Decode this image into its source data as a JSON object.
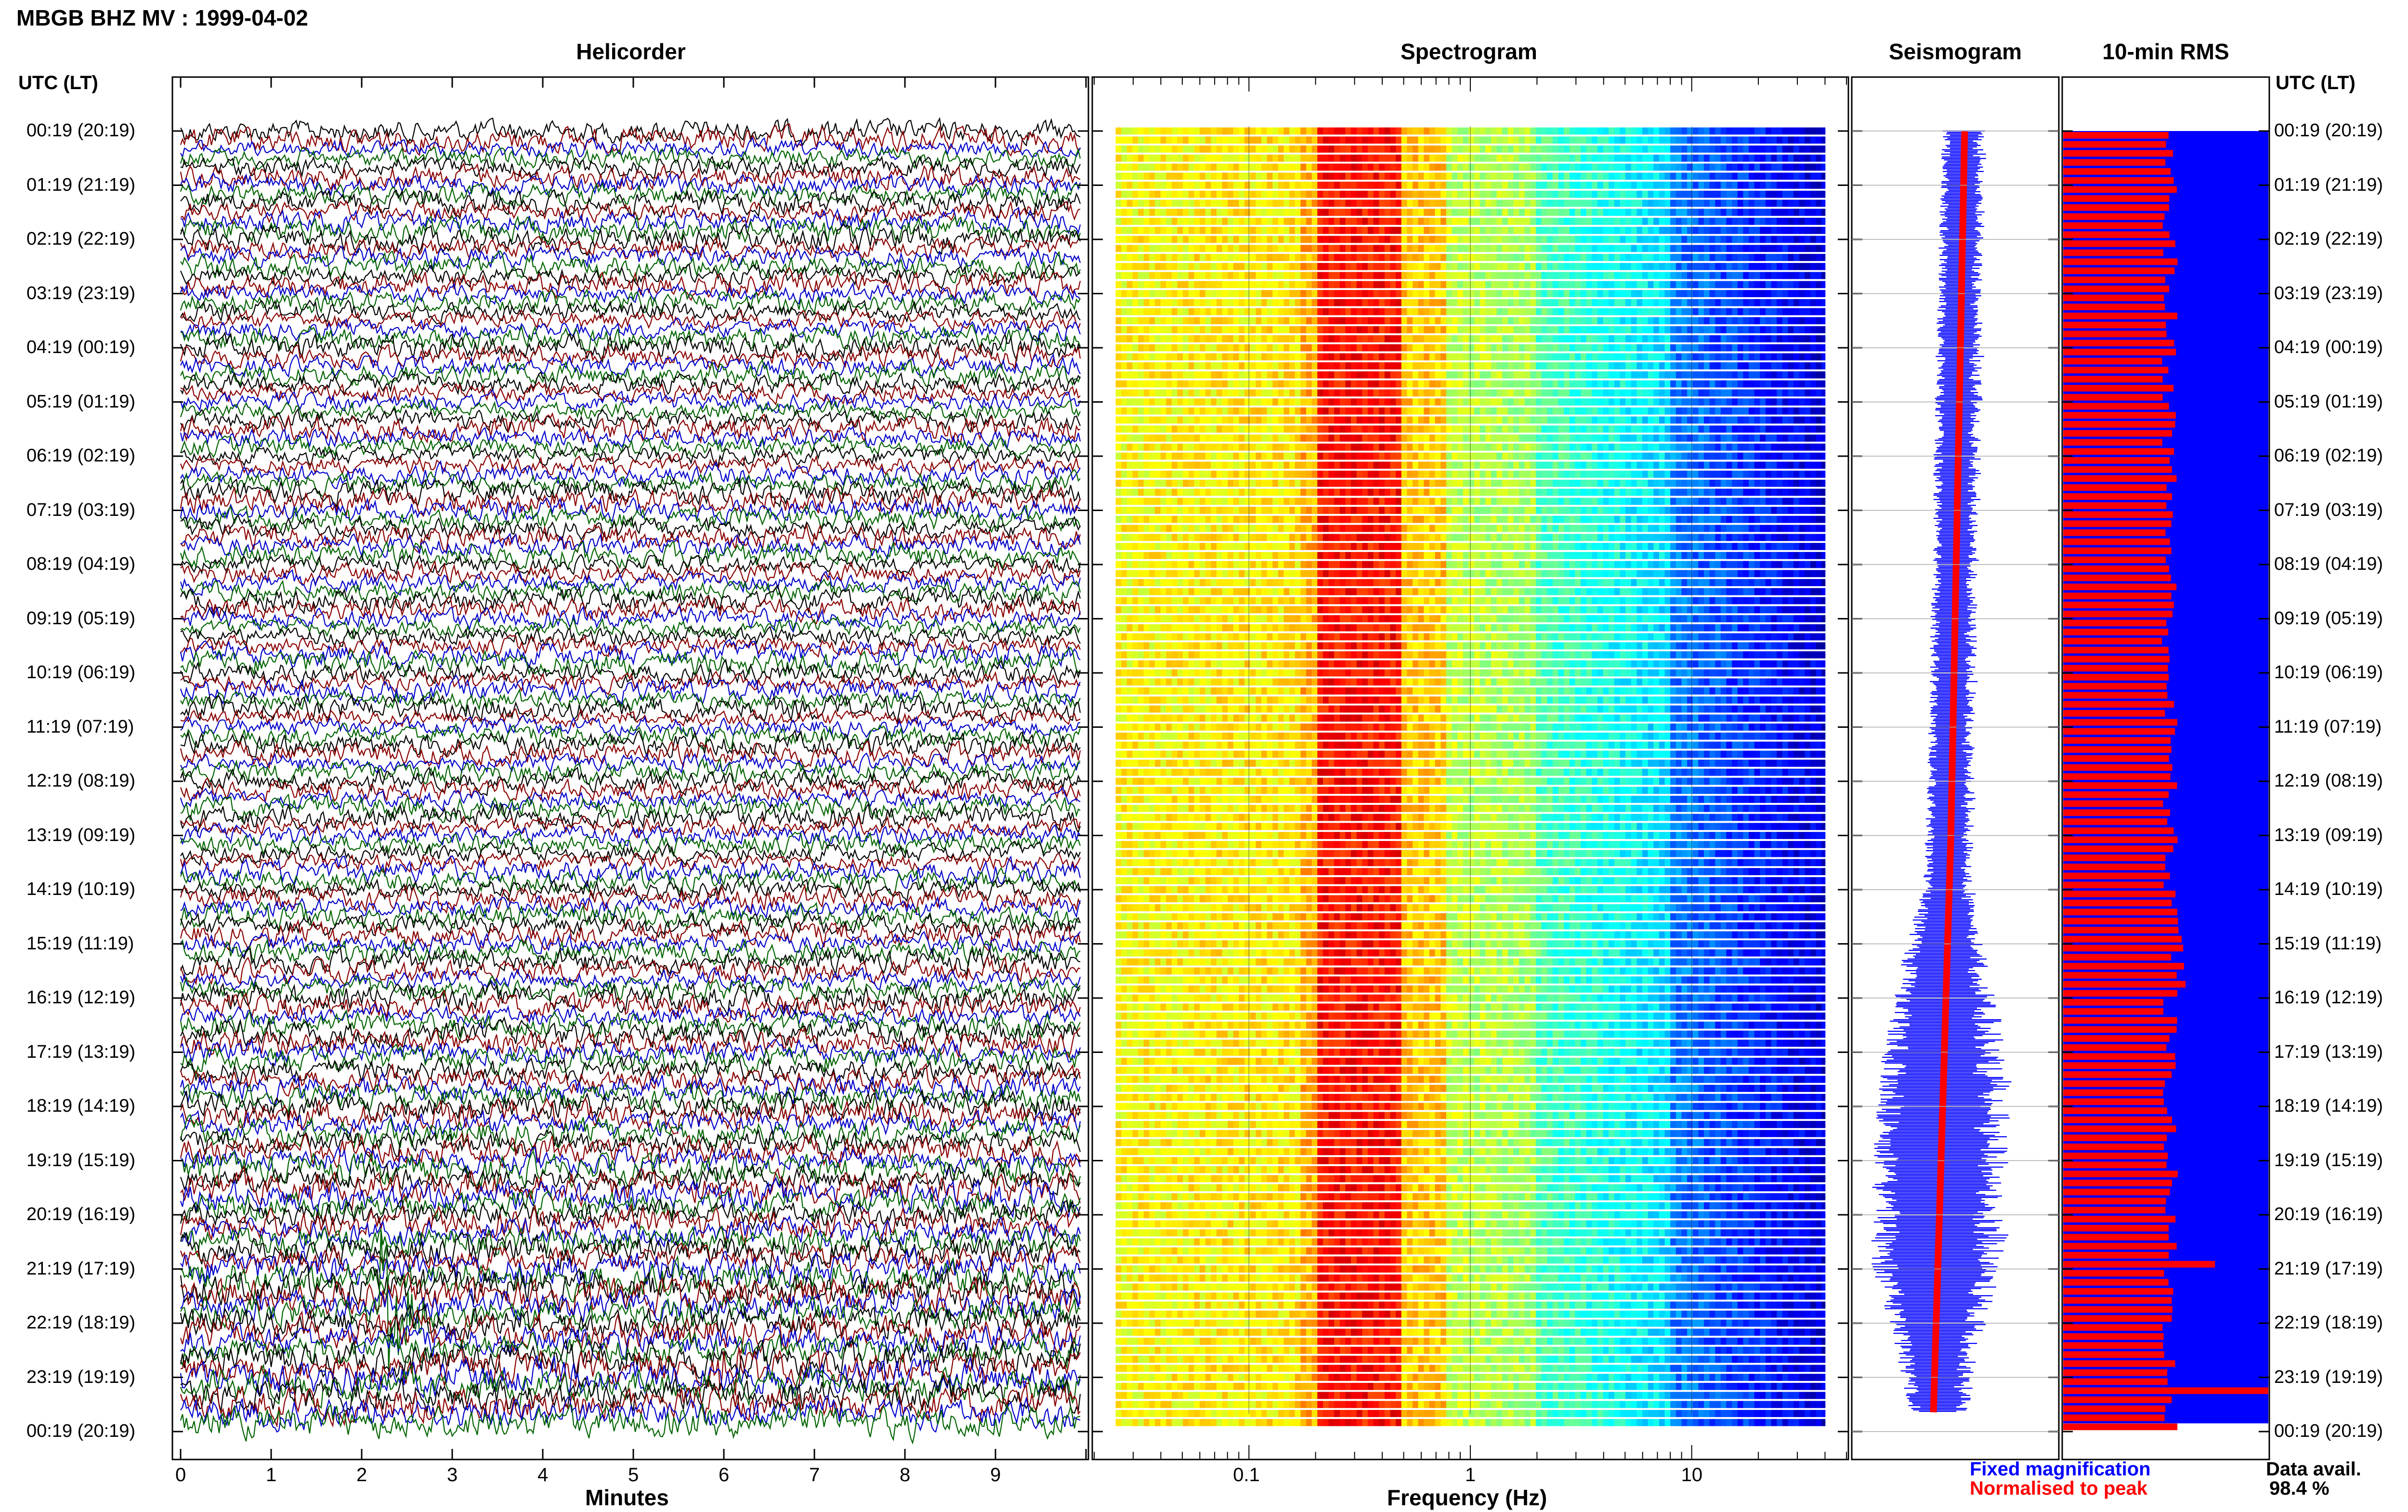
{
  "header": {
    "title": "MBGB BHZ MV : 1999-04-02"
  },
  "panels": {
    "helicorder": "Helicorder",
    "spectrogram": "Spectrogram",
    "seismogram": "Seismogram",
    "rms": "10-min RMS"
  },
  "axes": {
    "utc_label": "UTC (LT)",
    "minutes_label": "Minutes",
    "frequency_label": "Frequency (Hz)"
  },
  "legend": {
    "fixed": "Fixed magnification",
    "normalised": "Normalised to peak",
    "data_avail_label": "Data avail.",
    "data_avail_value": "98.4 %"
  },
  "colors": {
    "trace_cycle": [
      "#000000",
      "#8b0000",
      "#0000cc",
      "#006400"
    ],
    "fixed": "#0000ff",
    "normalised": "#ff0000"
  },
  "chart_data": [
    {
      "type": "line",
      "name": "helicorder",
      "title": "Helicorder",
      "xlabel": "Minutes",
      "xlim": [
        0,
        10
      ],
      "x_ticks": [
        "0",
        "1",
        "2",
        "3",
        "4",
        "5",
        "6",
        "7",
        "8",
        "9"
      ],
      "time_labels": [
        "00:19 (20:19)",
        "01:19 (21:19)",
        "02:19 (22:19)",
        "03:19 (23:19)",
        "04:19 (00:19)",
        "05:19 (01:19)",
        "06:19 (02:19)",
        "07:19 (03:19)",
        "08:19 (04:19)",
        "09:19 (05:19)",
        "10:19 (06:19)",
        "11:19 (07:19)",
        "12:19 (08:19)",
        "13:19 (09:19)",
        "14:19 (10:19)",
        "15:19 (11:19)",
        "16:19 (12:19)",
        "17:19 (13:19)",
        "18:19 (14:19)",
        "19:19 (15:19)",
        "20:19 (16:19)",
        "21:19 (17:19)",
        "22:19 (18:19)",
        "23:19 (19:19)",
        "00:19 (20:19)"
      ],
      "rows": 144,
      "events": [
        {
          "row": 150,
          "minute": 0.6,
          "amp": 3
        },
        {
          "row": 152,
          "minute": 1.0,
          "amp": 2.5
        },
        {
          "row": 131,
          "minute": 2.25,
          "amp": 8
        },
        {
          "row": 137,
          "minute": 6.0,
          "amp": 2
        }
      ]
    },
    {
      "type": "heatmap",
      "name": "spectrogram",
      "title": "Spectrogram",
      "xlabel": "Frequency (Hz)",
      "x_scale": "log",
      "xlim": [
        0.02,
        50
      ],
      "x_ticks": [
        "0.1",
        "1",
        "10"
      ],
      "dominant_band_hz": [
        0.2,
        0.5
      ],
      "rows": 144
    },
    {
      "type": "area",
      "name": "seismogram",
      "title": "Seismogram",
      "series_labels": [
        "Fixed magnification",
        "Normalised to peak"
      ],
      "width_profile_hours": [
        0,
        4,
        8,
        12,
        14,
        15,
        17,
        19,
        21,
        22,
        23,
        24
      ],
      "width_profile": [
        0.18,
        0.19,
        0.19,
        0.19,
        0.21,
        0.34,
        0.5,
        0.56,
        0.55,
        0.4,
        0.3,
        0.2
      ]
    },
    {
      "type": "bar",
      "name": "10-min RMS",
      "title": "10-min RMS",
      "bars": 144,
      "typical_fraction": 0.52,
      "peaks": [
        {
          "hour": 20.9,
          "fraction": 0.74
        },
        {
          "hour": 23.15,
          "fraction": 1.0
        }
      ]
    }
  ]
}
